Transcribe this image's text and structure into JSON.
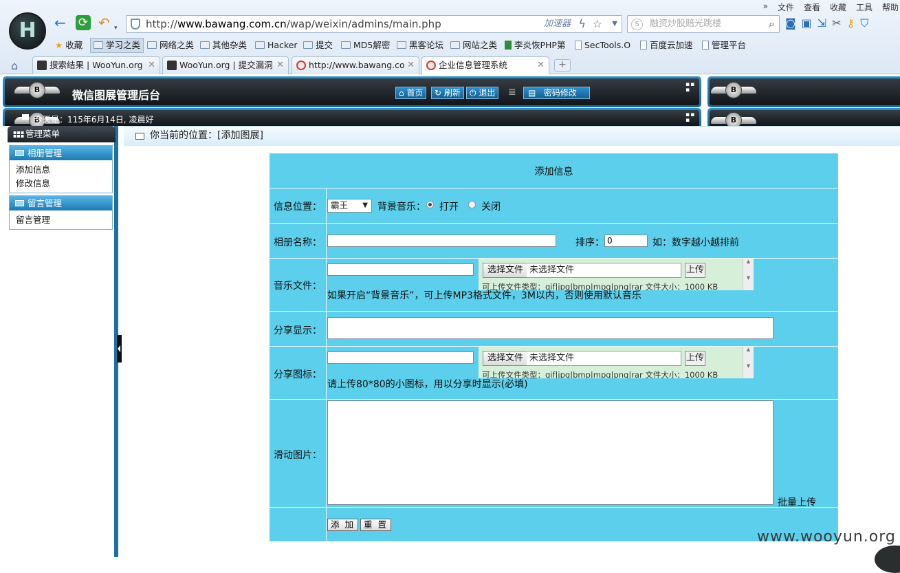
{
  "browser": {
    "menu": [
      "文件",
      "查看",
      "收藏",
      "工具",
      "帮助"
    ],
    "url_prefix": "http://",
    "url_domain": "www.bawang.com.cn",
    "url_path": "/wap/weixin/admins/main.php",
    "accelerator": "加速器",
    "search_placeholder": "融资炒股赔光跳楼",
    "bookmarks": [
      "收藏",
      "学习之类",
      "网络之类",
      "其他杂类",
      "Hacker",
      "提交",
      "MD5解密",
      "黑客论坛",
      "网站之类",
      "李炎恢PHP第",
      "SecTools.O",
      "百度云加速",
      "管理平台"
    ],
    "tabs": [
      "搜索结果 | WooYun.org",
      "WooYun.org | 提交漏洞",
      "http://www.bawang.co",
      "企业信息管理系统"
    ]
  },
  "header": {
    "title": "微信图展管理后台",
    "nav": [
      "首页",
      "刷新",
      "退出",
      "密码修改"
    ],
    "welcome": "今天是：115年6月14日, 凌晨好",
    "emblem": "B"
  },
  "sidebar": {
    "title": "管理菜单",
    "groups": [
      {
        "title": "相册管理",
        "items": [
          "添加信息",
          "修改信息"
        ]
      },
      {
        "title": "留言管理",
        "items": [
          "留言管理"
        ]
      }
    ]
  },
  "breadcrumb": "你当前的位置：[添加图展]",
  "form": {
    "title": "添加信息",
    "position_label": "信息位置：",
    "position_value": "霸王",
    "music_label": "背景音乐：",
    "music_on": "打开",
    "music_off": "关闭",
    "album_label": "相册名称：",
    "sort_label": "排序：",
    "sort_value": "0",
    "sort_hint": "如：数字越小越排前",
    "music_file_label": "音乐文件：",
    "choose_file": "选择文件",
    "no_file": "未选择文件",
    "upload": "上传",
    "upload_hint": "可上传文件类型：gif|jpg|bmp|mpg|png|rar   文件大小：1000 KB",
    "music_note": "如果开启“背景音乐”，可上传MP3格式文件，3M以内，否则使用默认音乐",
    "share_display_label": "分享显示：",
    "share_icon_label": "分享图标：",
    "share_icon_note": "请上传80*80的小图标，用以分享时显示(必填)",
    "slide_label": "滑动图片：",
    "batch_upload": "批量上传",
    "submit": "添 加",
    "reset": "重 置"
  },
  "watermark": "www.wooyun.org"
}
